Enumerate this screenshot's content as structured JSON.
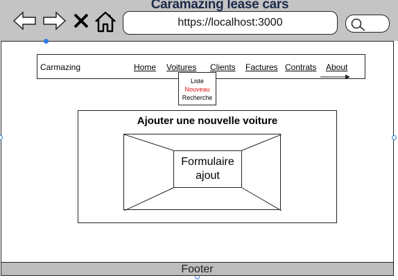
{
  "window": {
    "title": "Caramazing lease cars"
  },
  "browser": {
    "url": "https://localhost:3000"
  },
  "navbar": {
    "brand": "Carmazing",
    "links": [
      "Home",
      "Voitures",
      "Clients",
      "Factures",
      "Contrats",
      "About"
    ]
  },
  "dropdown": {
    "items": [
      "Liste",
      "Nouveau",
      "Recherche"
    ],
    "active_color": "#e01010"
  },
  "main": {
    "title": "Ajouter une nouvelle voiture",
    "form_label_line1": "Formulaire",
    "form_label_line2": "ajout"
  },
  "footer": {
    "text": "Footer"
  },
  "icons": [
    "back-arrow-icon",
    "forward-arrow-icon",
    "close-icon",
    "home-icon",
    "search-icon",
    "dropdown-arrow-icon"
  ]
}
